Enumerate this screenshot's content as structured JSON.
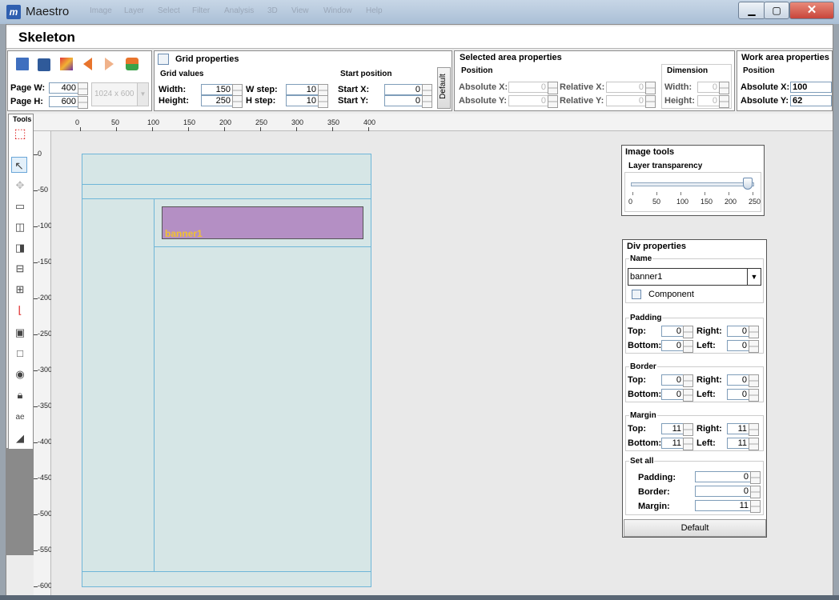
{
  "app": {
    "name": "Maestro",
    "icon_letter": "m"
  },
  "menu_blurred": [
    "Image",
    "Layer",
    "Select",
    "Filter",
    "Analysis",
    "3D",
    "View",
    "Window",
    "Help"
  ],
  "window_controls": {
    "minimize": "▁",
    "maximize": "▢",
    "close": "✕"
  },
  "document": {
    "title": "Skeleton"
  },
  "page_size": {
    "width_label": "Page W:",
    "width_value": "400",
    "height_label": "Page H:",
    "height_value": "600",
    "preset": "1024 x 600"
  },
  "grid": {
    "title": "Grid properties",
    "values_title": "Grid values",
    "width_label": "Width:",
    "width_value": "150",
    "height_label": "Height:",
    "height_value": "250",
    "wstep_label": "W step:",
    "wstep_value": "10",
    "hstep_label": "H step:",
    "hstep_value": "10",
    "start_title": "Start position",
    "startx_label": "Start X:",
    "startx_value": "0",
    "starty_label": "Start Y:",
    "starty_value": "0",
    "default_label": "Default"
  },
  "selected_area": {
    "title": "Selected area properties",
    "position_title": "Position",
    "absx_label": "Absolute X:",
    "absx_value": "0",
    "absy_label": "Absolute Y:",
    "absy_value": "0",
    "relx_label": "Relative X:",
    "relx_value": "0",
    "rely_label": "Relative Y:",
    "rely_value": "0",
    "dimension_title": "Dimension",
    "width_label": "Width:",
    "width_value": "0",
    "height_label": "Height:",
    "height_value": "0"
  },
  "work_area": {
    "title": "Work area properties",
    "position_title": "Position",
    "absx_label": "Absolute X:",
    "absx_value": "100",
    "absy_label": "Absolute Y:",
    "absy_value": "62"
  },
  "tools": {
    "title": "Tools"
  },
  "ruler": {
    "h": [
      "0",
      "50",
      "100",
      "150",
      "200",
      "250",
      "300",
      "350",
      "400"
    ],
    "v": [
      "0",
      "-50",
      "-100",
      "-150",
      "-200",
      "-250",
      "-300",
      "-350",
      "-400",
      "-450",
      "-500",
      "-550",
      "-600"
    ]
  },
  "canvas": {
    "banner_label": "banner1",
    "banner_color": "#b48fc4",
    "page_color": "#d6e6e6",
    "banner_text_color": "#f2c230"
  },
  "image_tools": {
    "title": "Image tools",
    "transparency_label": "Layer transparency",
    "slider_value": 240,
    "slider_max": 250,
    "ticks": [
      "0",
      "50",
      "100",
      "150",
      "200",
      "250"
    ]
  },
  "div_properties": {
    "title": "Div properties",
    "name_title": "Name",
    "name_value": "banner1",
    "component_label": "Component",
    "padding_title": "Padding",
    "padding": {
      "top": "0",
      "right": "0",
      "bottom": "0",
      "left": "0"
    },
    "border_title": "Border",
    "border": {
      "top": "0",
      "right": "0",
      "bottom": "0",
      "left": "0"
    },
    "margin_title": "Margin",
    "margin": {
      "top": "11",
      "right": "11",
      "bottom": "11",
      "left": "11"
    },
    "labels": {
      "top": "Top:",
      "right": "Right:",
      "bottom": "Bottom:",
      "left": "Left:"
    },
    "setall_title": "Set all",
    "setall": {
      "padding_label": "Padding:",
      "padding_value": "0",
      "border_label": "Border:",
      "border_value": "0",
      "margin_label": "Margin:",
      "margin_value": "11"
    },
    "default_label": "Default"
  }
}
